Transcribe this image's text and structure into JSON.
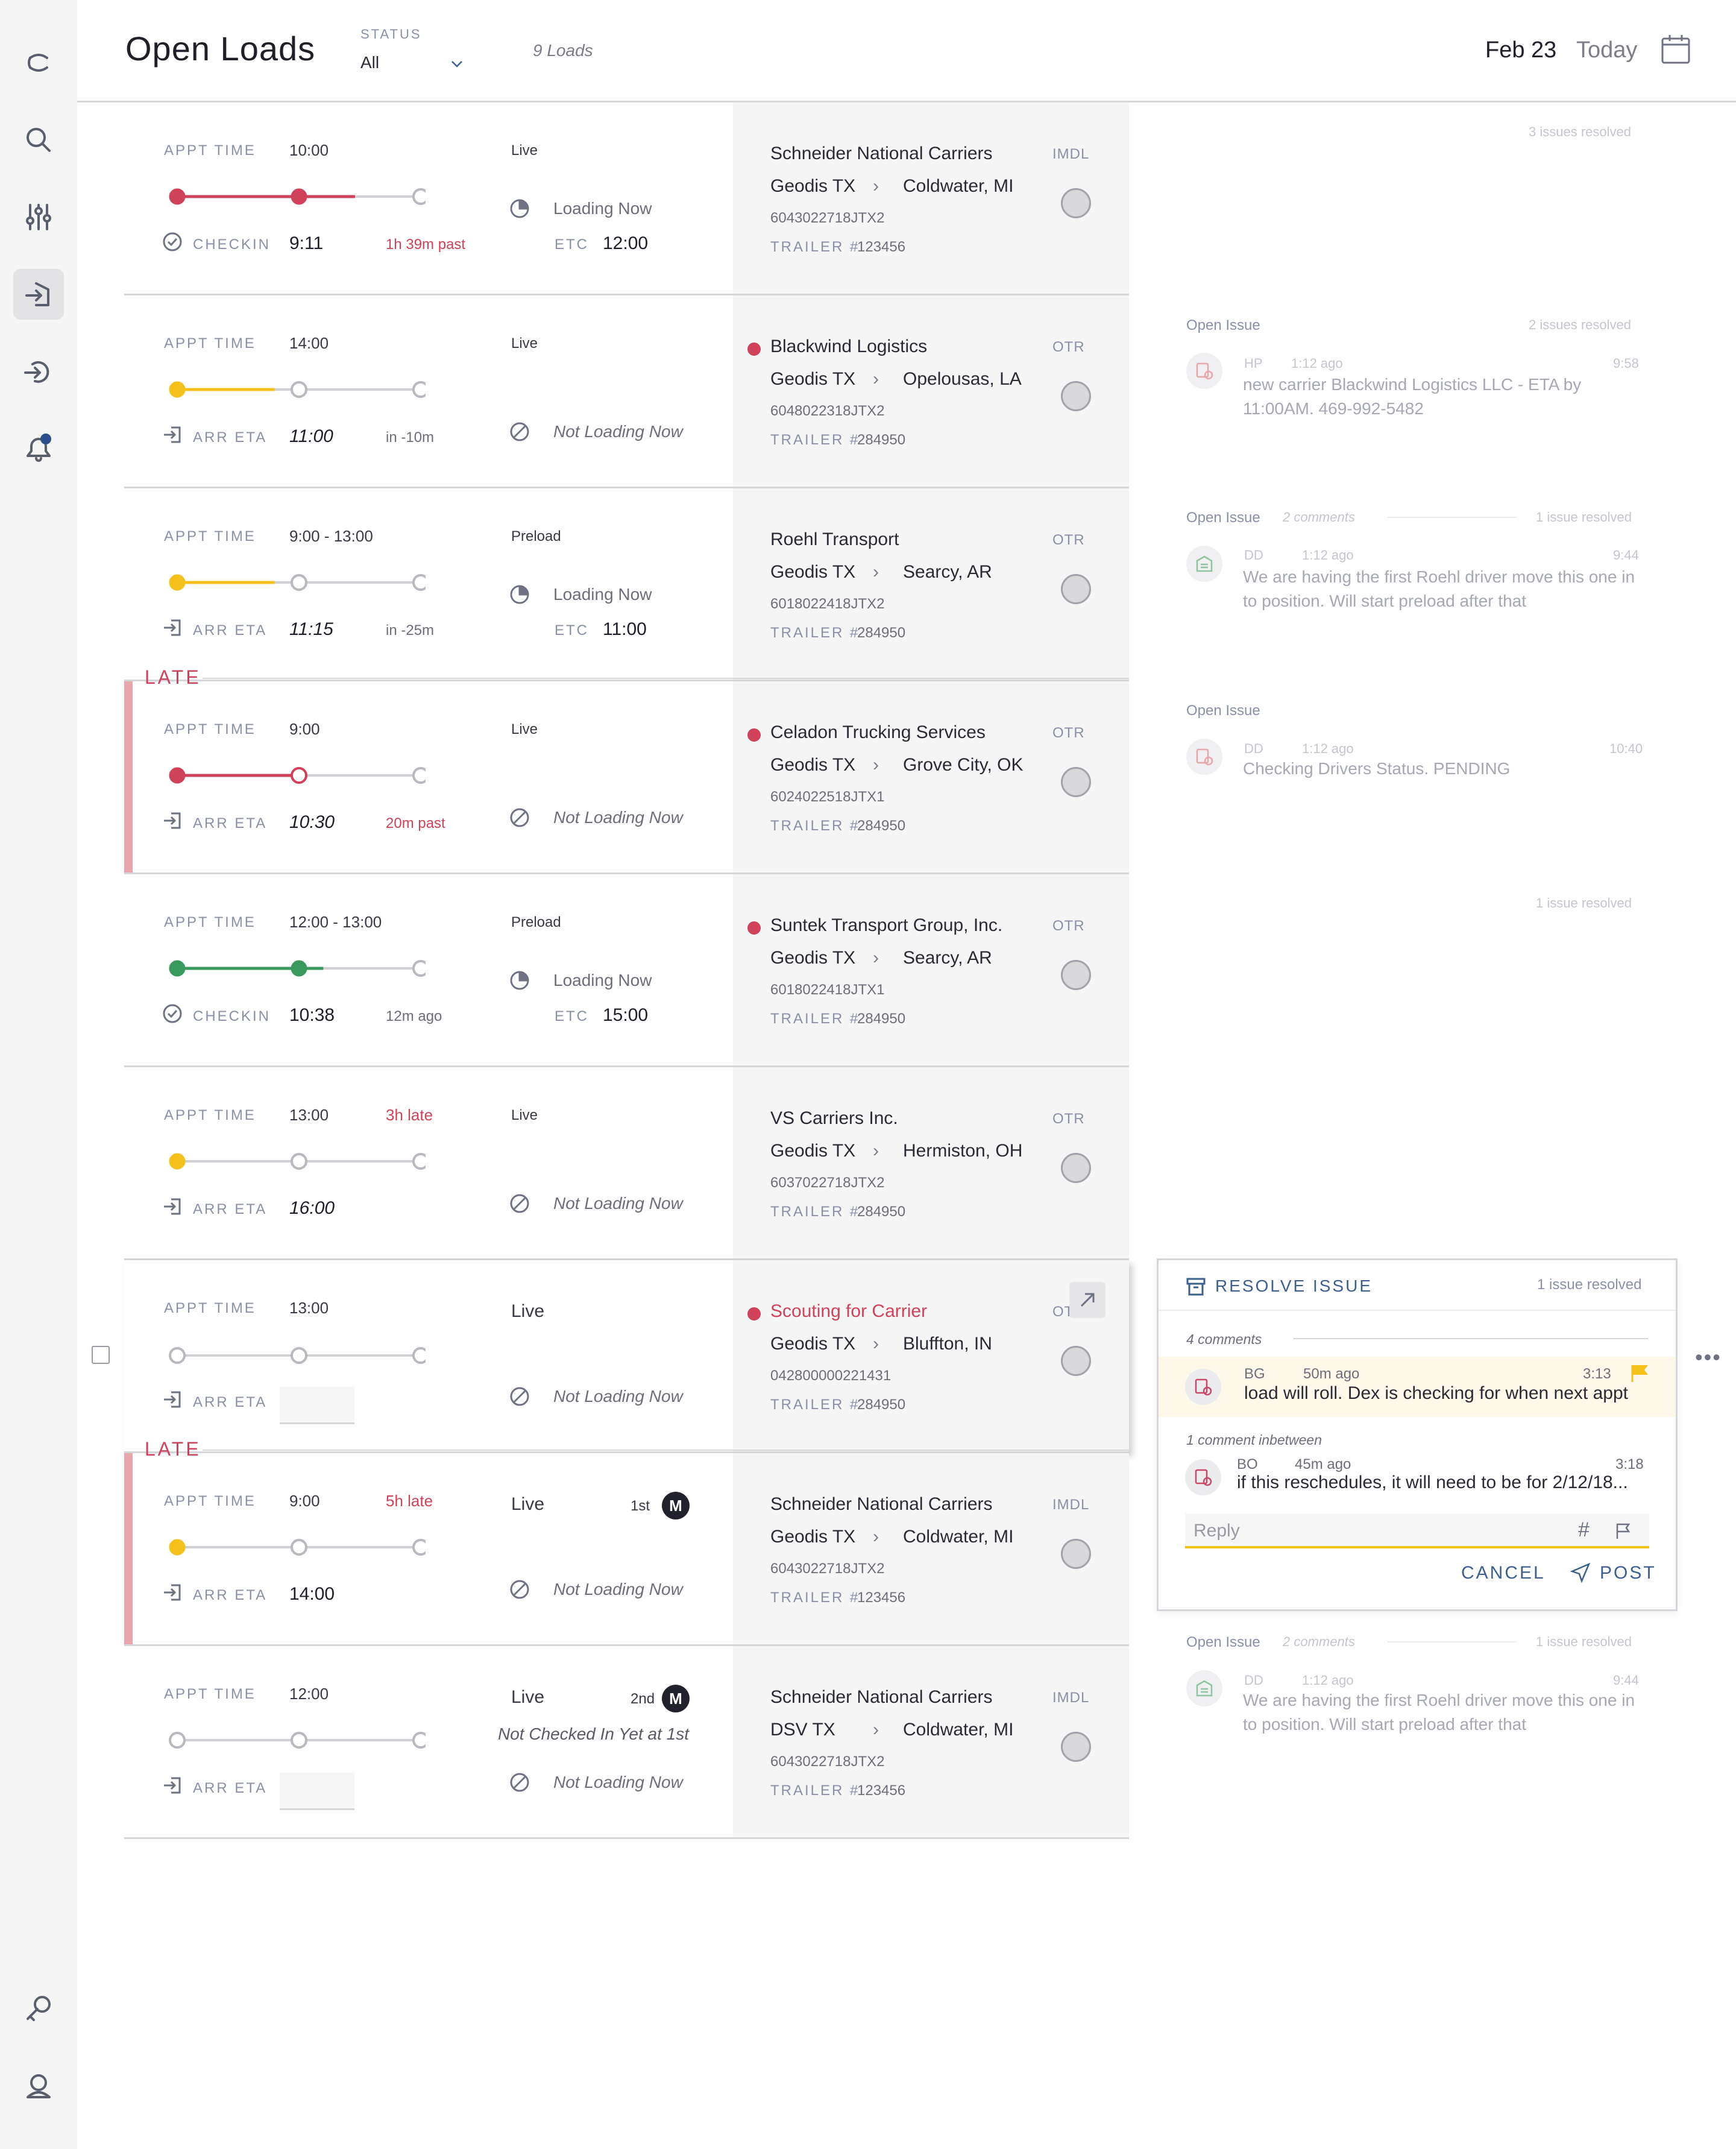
{
  "header": {
    "title": "Open Loads",
    "status_label": "STATUS",
    "status_value": "All",
    "loads_count": "9 Loads",
    "date": "Feb 23",
    "today": "Today"
  },
  "sidebar": {
    "items": [
      "logo-icon",
      "search-icon",
      "filters-icon",
      "inbound-icon",
      "outbound-icon",
      "notifications-icon",
      "key-icon",
      "user-icon"
    ]
  },
  "labels": {
    "appt_time": "APPT TIME",
    "checkin": "CHECKIN",
    "arr_eta": "ARR ETA",
    "loading_now": "Loading Now",
    "not_loading_now": "Not Loading Now",
    "etc": "ETC",
    "trailer": "TRAILER #",
    "late": "LATE"
  },
  "loads": [
    {
      "appt": "10:00",
      "appt_note": "",
      "type": "Live",
      "sub_label": "CHECKIN",
      "sub_time": "9:11",
      "sub_note": "1h 39m past",
      "sub_note_red": true,
      "loading": "Loading Now",
      "etc": "12:00",
      "carrier": "Schneider National Carriers",
      "carrier_dot": false,
      "mode": "IMDL",
      "origin": "Geodis TX",
      "dest": "Coldwater, MI",
      "ref": "6043022718JTX2",
      "trailer": "123456",
      "progress_color": "#d0425a",
      "progress": 0.73
    },
    {
      "appt": "14:00",
      "appt_note": "",
      "type": "Live",
      "sub_label": "ARR ETA",
      "sub_time": "11:00",
      "sub_note": "in -10m",
      "sub_note_red": false,
      "loading": "Not Loading Now",
      "etc": "",
      "carrier": "Blackwind Logistics",
      "carrier_dot": true,
      "mode": "OTR",
      "origin": "Geodis TX",
      "dest": "Opelousas, LA",
      "ref": "6048022318JTX2",
      "trailer": "284950",
      "progress_color": "#f3c01c",
      "progress": 0.4
    },
    {
      "appt": "9:00 - 13:00",
      "appt_note": "",
      "type": "Preload",
      "sub_label": "ARR ETA",
      "sub_time": "11:15",
      "sub_note": "in -25m",
      "sub_note_red": false,
      "loading": "Loading Now",
      "etc": "11:00",
      "carrier": "Roehl Transport",
      "carrier_dot": false,
      "mode": "OTR",
      "origin": "Geodis TX",
      "dest": "Searcy, AR",
      "ref": "6018022418JTX2",
      "trailer": "284950",
      "progress_color": "#f3c01c",
      "progress": 0.4
    },
    {
      "appt": "9:00",
      "appt_note": "",
      "type": "Live",
      "sub_label": "ARR ETA",
      "sub_time": "10:30",
      "sub_note": "20m past",
      "sub_note_red": true,
      "loading": "Not Loading Now",
      "etc": "",
      "carrier": "Celadon Trucking Services",
      "carrier_dot": true,
      "mode": "OTR",
      "origin": "Geodis TX",
      "dest": "Grove City, OK",
      "ref": "6024022518JTX1",
      "trailer": "284950",
      "progress_color": "#d0425a",
      "progress": 0.5
    },
    {
      "appt": "12:00 - 13:00",
      "appt_note": "",
      "type": "Preload",
      "sub_label": "CHECKIN",
      "sub_time": "10:38",
      "sub_note": "12m ago",
      "sub_note_red": false,
      "loading": "Loading Now",
      "etc": "15:00",
      "carrier": "Suntek Transport Group, Inc.",
      "carrier_dot": true,
      "mode": "OTR",
      "origin": "Geodis TX",
      "dest": "Searcy, AR",
      "ref": "6018022418JTX1",
      "trailer": "284950",
      "progress_color": "#3a9a5e",
      "progress": 0.6
    },
    {
      "appt": "13:00",
      "appt_note": "3h late",
      "type": "Live",
      "sub_label": "ARR ETA",
      "sub_time": "16:00",
      "sub_note": "",
      "sub_note_red": false,
      "loading": "Not Loading Now",
      "etc": "",
      "carrier": "VS Carriers Inc.",
      "carrier_dot": false,
      "mode": "OTR",
      "origin": "Geodis TX",
      "dest": "Hermiston, OH",
      "ref": "6037022718JTX2",
      "trailer": "284950",
      "progress_color": "#f3c01c",
      "progress": 0
    },
    {
      "appt": "13:00",
      "appt_note": "",
      "type": "Live",
      "sub_label": "ARR ETA",
      "sub_time": "",
      "sub_note": "",
      "sub_note_red": false,
      "loading": "Not Loading Now",
      "etc": "",
      "carrier": "Scouting for Carrier",
      "carrier_dot": true,
      "mode": "OTR",
      "origin": "Geodis TX",
      "dest": "Bluffton, IN",
      "ref": "042800000221431",
      "trailer": "284950",
      "progress_color": "#c8c8cc",
      "progress": 0
    },
    {
      "appt": "9:00",
      "appt_note": "5h late",
      "type": "Live",
      "sub_label": "ARR ETA",
      "sub_time": "14:00",
      "sub_note": "",
      "sub_note_red": false,
      "loading": "Not Loading Now",
      "etc": "",
      "carrier": "Schneider National Carriers",
      "carrier_dot": false,
      "mode": "IMDL",
      "origin": "Geodis TX",
      "dest": "Coldwater, MI",
      "ref": "6043022718JTX2",
      "trailer": "123456",
      "progress_color": "#f3c01c",
      "progress": 0,
      "badge_label": "1st",
      "badge": "M"
    },
    {
      "appt": "12:00",
      "appt_note": "",
      "type": "Live",
      "sub_label": "ARR ETA",
      "sub_time": "",
      "sub_note": "",
      "sub_note_red": false,
      "loading": "Not Loading Now",
      "etc": "",
      "carrier": "Schneider National Carriers",
      "carrier_dot": false,
      "mode": "IMDL",
      "origin": "DSV TX",
      "dest": "Coldwater, MI",
      "ref": "6043022718JTX2",
      "trailer": "123456",
      "progress_color": "#c8c8cc",
      "progress": 0,
      "badge_label": "2nd",
      "badge": "M",
      "extra_note": "Not Checked In Yet at 1st"
    }
  ],
  "issues": {
    "row1_resolved": "3 issues resolved",
    "row2": {
      "head": "Open Issue",
      "resolved": "2 issues resolved",
      "initials": "HP",
      "ago": "1:12 ago",
      "time": "9:58",
      "body": "new carrier Blackwind Logistics LLC - ETA by 11:00AM.  469-992-5482"
    },
    "row3": {
      "head": "Open Issue",
      "comments": "2 comments",
      "resolved": "1 issue resolved",
      "initials": "DD",
      "ago": "1:12 ago",
      "time": "9:44",
      "body": "We are having the first Roehl driver move this one in to position.  Will start preload after that"
    },
    "row4": {
      "head": "Open Issue",
      "initials": "DD",
      "ago": "1:12 ago",
      "time": "10:40",
      "body": "Checking Drivers Status. PENDING"
    },
    "row5_resolved": "1 issue resolved",
    "row9": {
      "head": "Open Issue",
      "comments": "2 comments",
      "resolved": "1 issue resolved",
      "initials": "DD",
      "ago": "1:12 ago",
      "time": "9:44",
      "body": "We are having the first Roehl driver move this one in to position.  Will start preload after that"
    }
  },
  "popup": {
    "resolve": "RESOLVE ISSUE",
    "resolved": "1 issue resolved",
    "comments_count": "4 comments",
    "c1": {
      "initials": "BG",
      "ago": "50m ago",
      "time": "3:13",
      "body": "load will roll.  Dex is checking for when next appt"
    },
    "between": "1 comment inbetween",
    "c2": {
      "initials": "BO",
      "ago": "45m ago",
      "time": "3:18",
      "body": "if this reschedules, it will need to be for 2/12/18..."
    },
    "reply_placeholder": "Reply",
    "cancel": "CANCEL",
    "post": "POST"
  },
  "colors": {
    "accent_red": "#d0425a",
    "accent_yellow": "#f3c01c",
    "accent_green": "#3a9a5e",
    "link_blue": "#3c5f8c"
  }
}
